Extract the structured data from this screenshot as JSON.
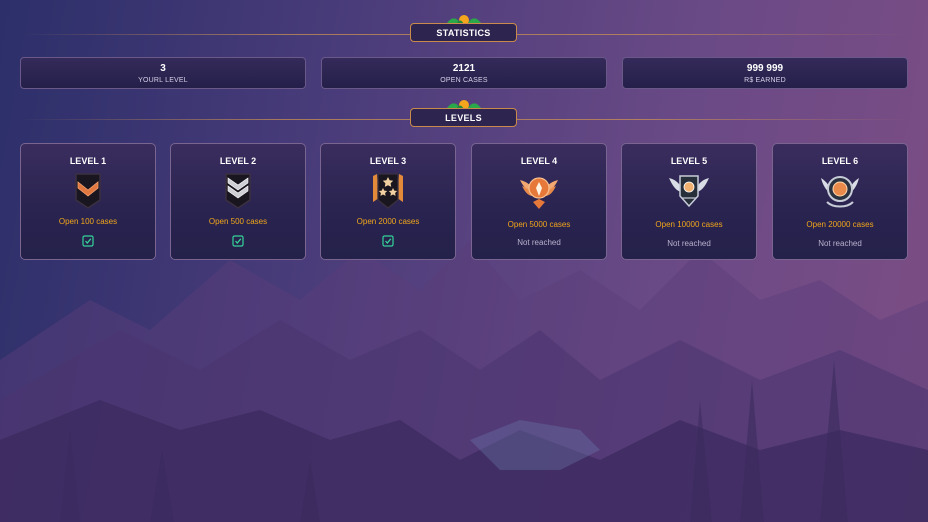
{
  "sections": {
    "statistics_label": "STATISTICS",
    "levels_label": "LEVELS"
  },
  "stats": [
    {
      "value": "3",
      "label": "YOURL LEVEL"
    },
    {
      "value": "2121",
      "label": "OPEN CASES"
    },
    {
      "value": "999 999",
      "label": "R$ EARNED"
    }
  ],
  "levels": [
    {
      "title": "LEVEL 1",
      "requirement": "Open 100 cases",
      "status": "reached",
      "badge": "chevron-single-icon"
    },
    {
      "title": "LEVEL 2",
      "requirement": "Open 500 cases",
      "status": "reached",
      "badge": "chevron-double-icon"
    },
    {
      "title": "LEVEL 3",
      "requirement": "Open 2000 cases",
      "status": "reached",
      "badge": "three-star-shield-icon"
    },
    {
      "title": "LEVEL 4",
      "requirement": "Open 5000 cases",
      "status_text": "Not reached",
      "badge": "winged-emblem-icon"
    },
    {
      "title": "LEVEL 5",
      "requirement": "Open 10000 cases",
      "status_text": "Not reached",
      "badge": "silver-winged-shield-icon"
    },
    {
      "title": "LEVEL 6",
      "requirement": "Open 20000 cases",
      "status_text": "Not reached",
      "badge": "silver-wreath-emblem-icon"
    }
  ],
  "colors": {
    "accent": "#f1a51a",
    "check": "#34d399",
    "border": "#c98a4a"
  }
}
